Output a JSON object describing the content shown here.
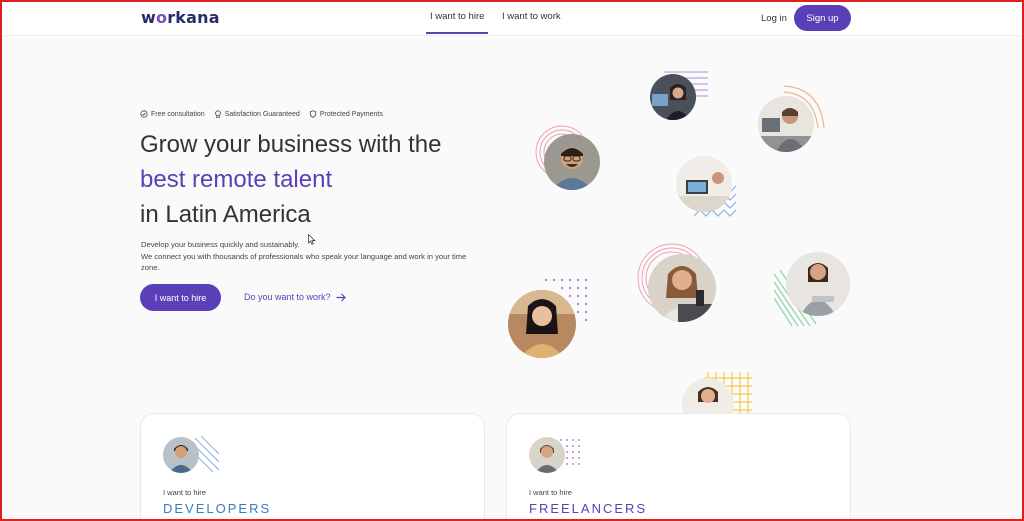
{
  "header": {
    "logo_text": "workana",
    "tabs": [
      {
        "label": "I want to hire",
        "active": true
      },
      {
        "label": "I want to work",
        "active": false
      }
    ],
    "login_label": "Log in",
    "signup_label": "Sign up"
  },
  "hero": {
    "badges": [
      {
        "icon": "check-circle-icon",
        "label": "Free consultation"
      },
      {
        "icon": "medal-icon",
        "label": "Satisfaction Guaranteed"
      },
      {
        "icon": "shield-icon",
        "label": "Protected Payments"
      }
    ],
    "title_line1": "Grow your business with the",
    "title_line2": "best remote talent",
    "title_line3": "in Latin America",
    "desc_line1": "Develop your business quickly and sustainably.",
    "desc_line2": "We connect you with thousands of professionals who speak your language and work in your time zone.",
    "hire_button": "I want to hire",
    "work_link": "Do you want to work?"
  },
  "cards": [
    {
      "kicker": "I want to hire",
      "category": "DEVELOPERS",
      "color": "#3a7ac0"
    },
    {
      "kicker": "I want to hire",
      "category": "FREELANCERS",
      "color": "#5b3fb7"
    }
  ],
  "colors": {
    "brand": "#5b3fb7",
    "logo": "#2a2a6e"
  }
}
